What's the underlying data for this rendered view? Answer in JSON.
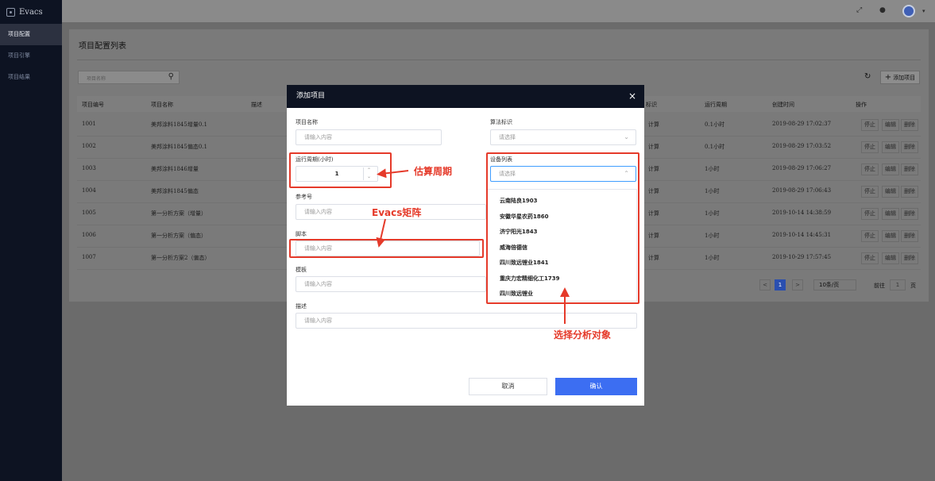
{
  "app": {
    "title": "Evacs"
  },
  "sidebar": {
    "items": [
      {
        "label": "项目配置",
        "active": true
      },
      {
        "label": "项目引擎",
        "active": false
      },
      {
        "label": "项目结果",
        "active": false
      }
    ]
  },
  "topbar": {
    "icons": [
      "expand-icon",
      "info-icon",
      "avatar",
      "chevron-down-icon"
    ]
  },
  "page": {
    "title": "项目配置列表",
    "search_placeholder": "项目名称",
    "add_button": "添加项目"
  },
  "table": {
    "headers": [
      "项目编号",
      "项目名称",
      "描述",
      "标识",
      "运行周期",
      "创建时间",
      "操作"
    ],
    "rows": [
      {
        "id": "1001",
        "name": "美邦涂料1845增量0.1",
        "algo": "计算",
        "cycle": "0.1小时",
        "created": "2019-08-29 17:02:37"
      },
      {
        "id": "1002",
        "name": "美邦涂料1845偏态0.1",
        "algo": "计算",
        "cycle": "0.1小时",
        "created": "2019-08-29 17:03:52"
      },
      {
        "id": "1003",
        "name": "美邦涂料1846增量",
        "algo": "计算",
        "cycle": "1小时",
        "created": "2019-08-29 17:06:27"
      },
      {
        "id": "1004",
        "name": "美邦涂料1845偏态",
        "algo": "计算",
        "cycle": "1小时",
        "created": "2019-08-29 17:06:43"
      },
      {
        "id": "1005",
        "name": "第一分析方案（增量）",
        "algo": "计算",
        "cycle": "1小时",
        "created": "2019-10-14 14:38:59"
      },
      {
        "id": "1006",
        "name": "第一分析方案（偏态）",
        "algo": "计算",
        "cycle": "1小时",
        "created": "2019-10-14 14:45:31"
      },
      {
        "id": "1007",
        "name": "第一分析方案2（偏态）",
        "algo": "计算",
        "cycle": "1小时",
        "created": "2019-10-29 17:57:45"
      }
    ],
    "actions": [
      "停止",
      "编辑",
      "删除"
    ]
  },
  "pagination": {
    "prev": "<",
    "current": "1",
    "next": ">",
    "page_size": "10条/页",
    "goto_label": "前往",
    "goto_value": "1",
    "page_suffix": "页"
  },
  "modal": {
    "title": "添加项目",
    "close": "×",
    "fields": {
      "name": {
        "label": "项目名称",
        "placeholder": "请输入内容"
      },
      "algo": {
        "label": "算法标识",
        "placeholder": "请选择"
      },
      "cycle": {
        "label": "运行周期(小时)",
        "value": "1"
      },
      "devices": {
        "label": "设备列表",
        "placeholder": "请选择"
      },
      "ref": {
        "label": "参考号",
        "placeholder": "请输入内容"
      },
      "script": {
        "label": "脚本",
        "placeholder": "请输入内容"
      },
      "template": {
        "label": "模板",
        "placeholder": "请输入内容"
      },
      "desc": {
        "label": "描述",
        "placeholder": "请输入内容"
      }
    },
    "device_options": [
      "云南陆良1903",
      "安徽华星农药1860",
      "济宁阳光1843",
      "威海倍德信",
      "四川致远锂业1841",
      "重庆力宏精细化工1739",
      "四川致远锂业"
    ],
    "cancel": "取消",
    "confirm": "确认"
  },
  "annotations": {
    "cycle": "估算周期",
    "script": "Evacs矩阵",
    "devices": "选择分析对象",
    "color": "#e53a2a"
  }
}
